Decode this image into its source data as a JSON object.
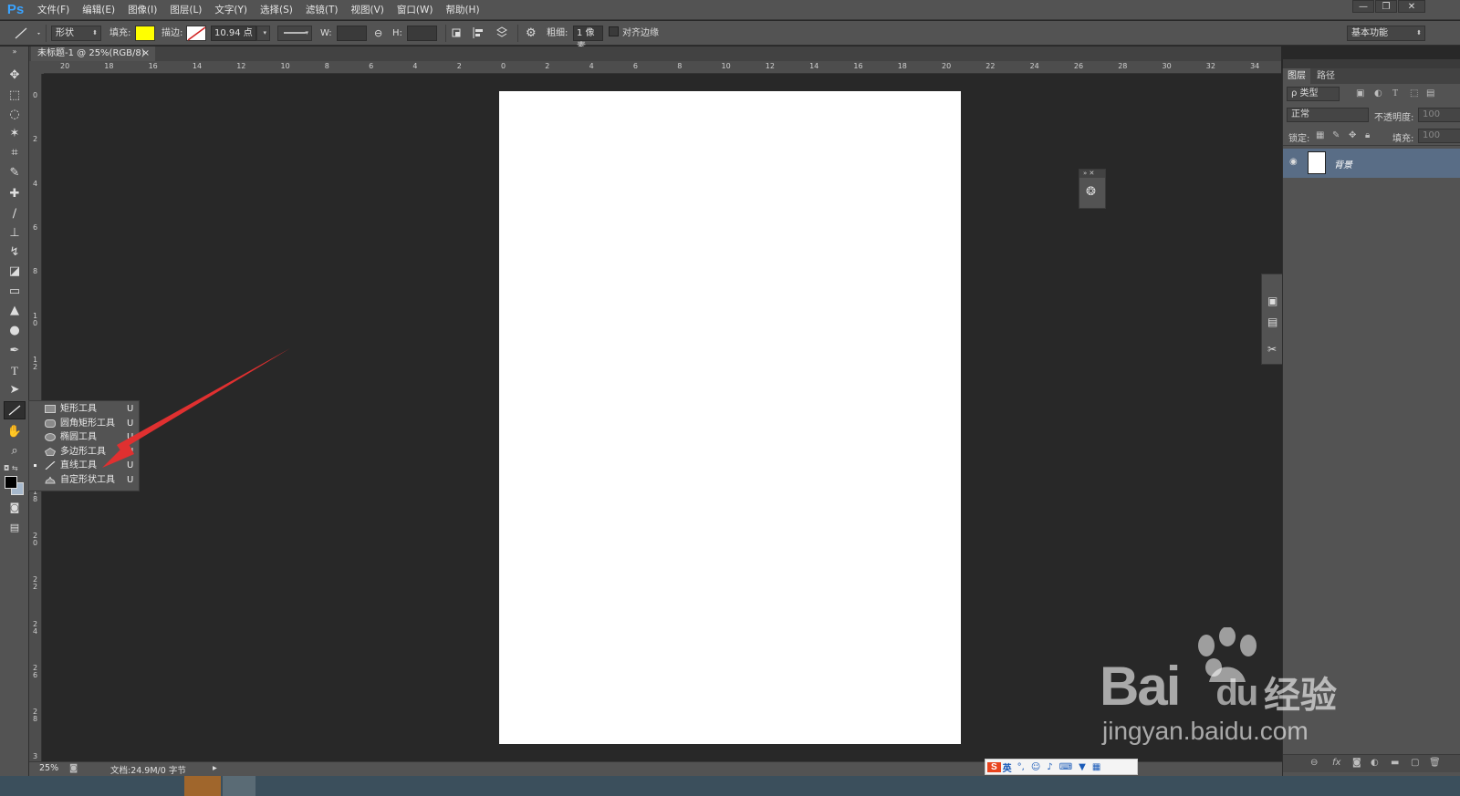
{
  "app": {
    "logo": "Ps"
  },
  "menu": [
    "文件(F)",
    "编辑(E)",
    "图像(I)",
    "图层(L)",
    "文字(Y)",
    "选择(S)",
    "滤镜(T)",
    "视图(V)",
    "窗口(W)",
    "帮助(H)"
  ],
  "window_controls": [
    "—",
    "❐",
    "✕"
  ],
  "options": {
    "mode_select": "形状",
    "fill_label": "填充:",
    "fill_color": "#ffff00",
    "stroke_label": "描边:",
    "stroke_size": "10.94 点",
    "w_label": "W:",
    "h_label": "H:",
    "weight_label": "粗细:",
    "weight_value": "1 像素",
    "align_edges_label": "对齐边缘",
    "workspace": "基本功能"
  },
  "document": {
    "tab_title": "未标题-1 @ 25%(RGB/8)",
    "tab_close": "×"
  },
  "ruler": {
    "top_labels": [
      "20",
      "18",
      "16",
      "14",
      "12",
      "10",
      "8",
      "6",
      "4",
      "2",
      "0",
      "2",
      "4",
      "6",
      "8",
      "10",
      "12",
      "14",
      "16",
      "18",
      "20",
      "22",
      "24",
      "26",
      "28",
      "30",
      "32",
      "34"
    ],
    "left_labels": [
      "0",
      "2",
      "4",
      "6",
      "8",
      "10",
      "12",
      "14",
      "16",
      "18",
      "20",
      "22",
      "24",
      "26",
      "28",
      "3"
    ]
  },
  "flyout": [
    {
      "label": "矩形工具",
      "key": "U",
      "icon": "rectangle-icon",
      "selected": false
    },
    {
      "label": "圆角矩形工具",
      "key": "U",
      "icon": "rounded-rectangle-icon",
      "selected": false
    },
    {
      "label": "椭圆工具",
      "key": "U",
      "icon": "ellipse-icon",
      "selected": false
    },
    {
      "label": "多边形工具",
      "key": "U",
      "icon": "polygon-icon",
      "selected": false
    },
    {
      "label": "直线工具",
      "key": "U",
      "icon": "line-icon",
      "selected": true
    },
    {
      "label": "自定形状工具",
      "key": "U",
      "icon": "custom-shape-icon",
      "selected": false
    }
  ],
  "annotation": {
    "arrow_color": "#e03030"
  },
  "layers_panel": {
    "tabs": [
      "图层",
      "路径"
    ],
    "filter_select": "ρ 类型",
    "blend_mode": "正常",
    "opacity_label": "不透明度:",
    "opacity_value": "100",
    "lock_label": "锁定:",
    "fill_label": "填充:",
    "fill_value": "100",
    "layer_name": "背景"
  },
  "status": {
    "zoom": "25%",
    "doc_info": "文档:24.9M/0 字节"
  },
  "ime": {
    "lang": "英"
  },
  "watermark": {
    "brand": "Bai",
    "brand_tail": "du",
    "product": "经验",
    "url": "jingyan.baidu.com"
  }
}
